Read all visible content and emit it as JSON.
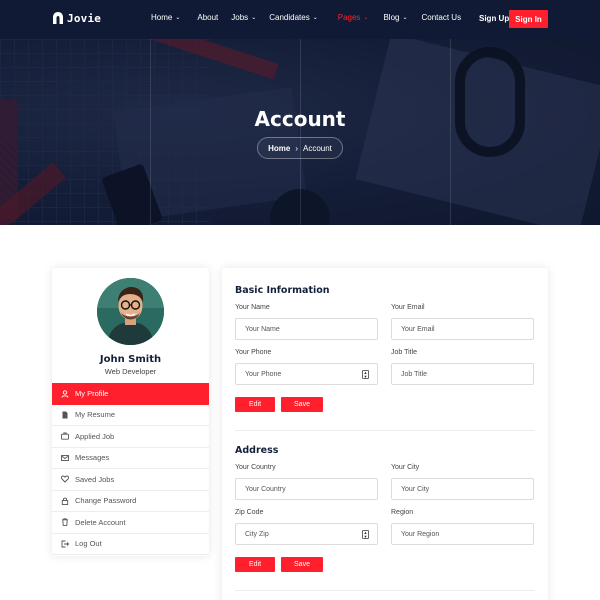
{
  "nav": {
    "brand": "Jovie",
    "menu": [
      {
        "label": "Home",
        "caret": true,
        "active": false
      },
      {
        "label": "About",
        "caret": false,
        "active": false
      },
      {
        "label": "Jobs",
        "caret": true,
        "active": false
      },
      {
        "label": "Candidates",
        "caret": true,
        "active": false
      },
      {
        "label": "Pages",
        "caret": true,
        "active": true
      },
      {
        "label": "Blog",
        "caret": true,
        "active": false
      },
      {
        "label": "Contact Us",
        "caret": false,
        "active": false
      }
    ],
    "signup": "Sign Up",
    "signin": "Sign In"
  },
  "hero": {
    "title": "Account",
    "breadcrumb_home": "Home",
    "breadcrumb_current": "Account"
  },
  "profile": {
    "name": "John Smith",
    "role": "Web Developer",
    "menu": [
      {
        "label": "My Profile",
        "icon": "user-icon",
        "active": true
      },
      {
        "label": "My Resume",
        "icon": "document-icon",
        "active": false
      },
      {
        "label": "Applied Job",
        "icon": "briefcase-icon",
        "active": false
      },
      {
        "label": "Messages",
        "icon": "envelope-icon",
        "active": false
      },
      {
        "label": "Saved Jobs",
        "icon": "heart-icon",
        "active": false
      },
      {
        "label": "Change Password",
        "icon": "lock-icon",
        "active": false
      },
      {
        "label": "Delete Account",
        "icon": "trash-icon",
        "active": false
      },
      {
        "label": "Log Out",
        "icon": "logout-icon",
        "active": false
      }
    ]
  },
  "basic": {
    "title": "Basic Information",
    "name_label": "Your Name",
    "name_placeholder": "Your Name",
    "email_label": "Your Email",
    "email_placeholder": "Your Email",
    "phone_label": "Your Phone",
    "phone_placeholder": "Your Phone",
    "job_label": "Job Title",
    "job_placeholder": "Job Title",
    "edit": "Edit",
    "save": "Save"
  },
  "address": {
    "title": "Address",
    "country_label": "Your Country",
    "country_placeholder": "Your Country",
    "city_label": "Your City",
    "city_placeholder": "Your City",
    "zip_label": "Zip Code",
    "zip_placeholder": "City Zip",
    "region_label": "Region",
    "region_placeholder": "Your Region",
    "edit": "Edit",
    "save": "Save"
  },
  "colors": {
    "accent": "#ff1f2d",
    "navy": "#101a35"
  }
}
